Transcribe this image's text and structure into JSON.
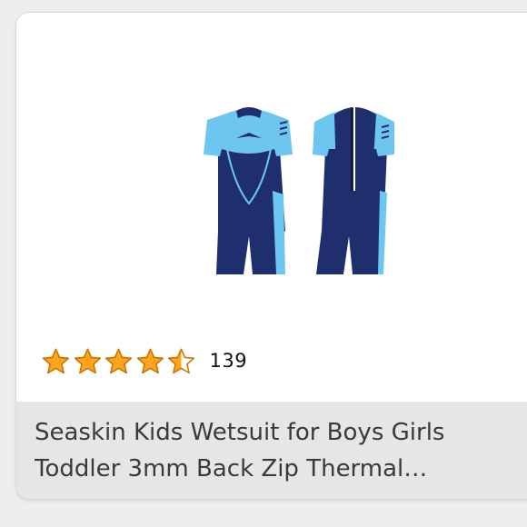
{
  "product": {
    "image_alt": "wetsuit-product-image",
    "rating": {
      "value": 4.5,
      "max": 5,
      "count": "139"
    },
    "title": "Seaskin Kids Wetsuit for Boys Girls Toddler 3mm Back Zip Thermal Swimsuit",
    "colors": {
      "star": "#ffa41c",
      "navy": "#1f2f6e",
      "light_blue": "#6cc6ef"
    }
  }
}
